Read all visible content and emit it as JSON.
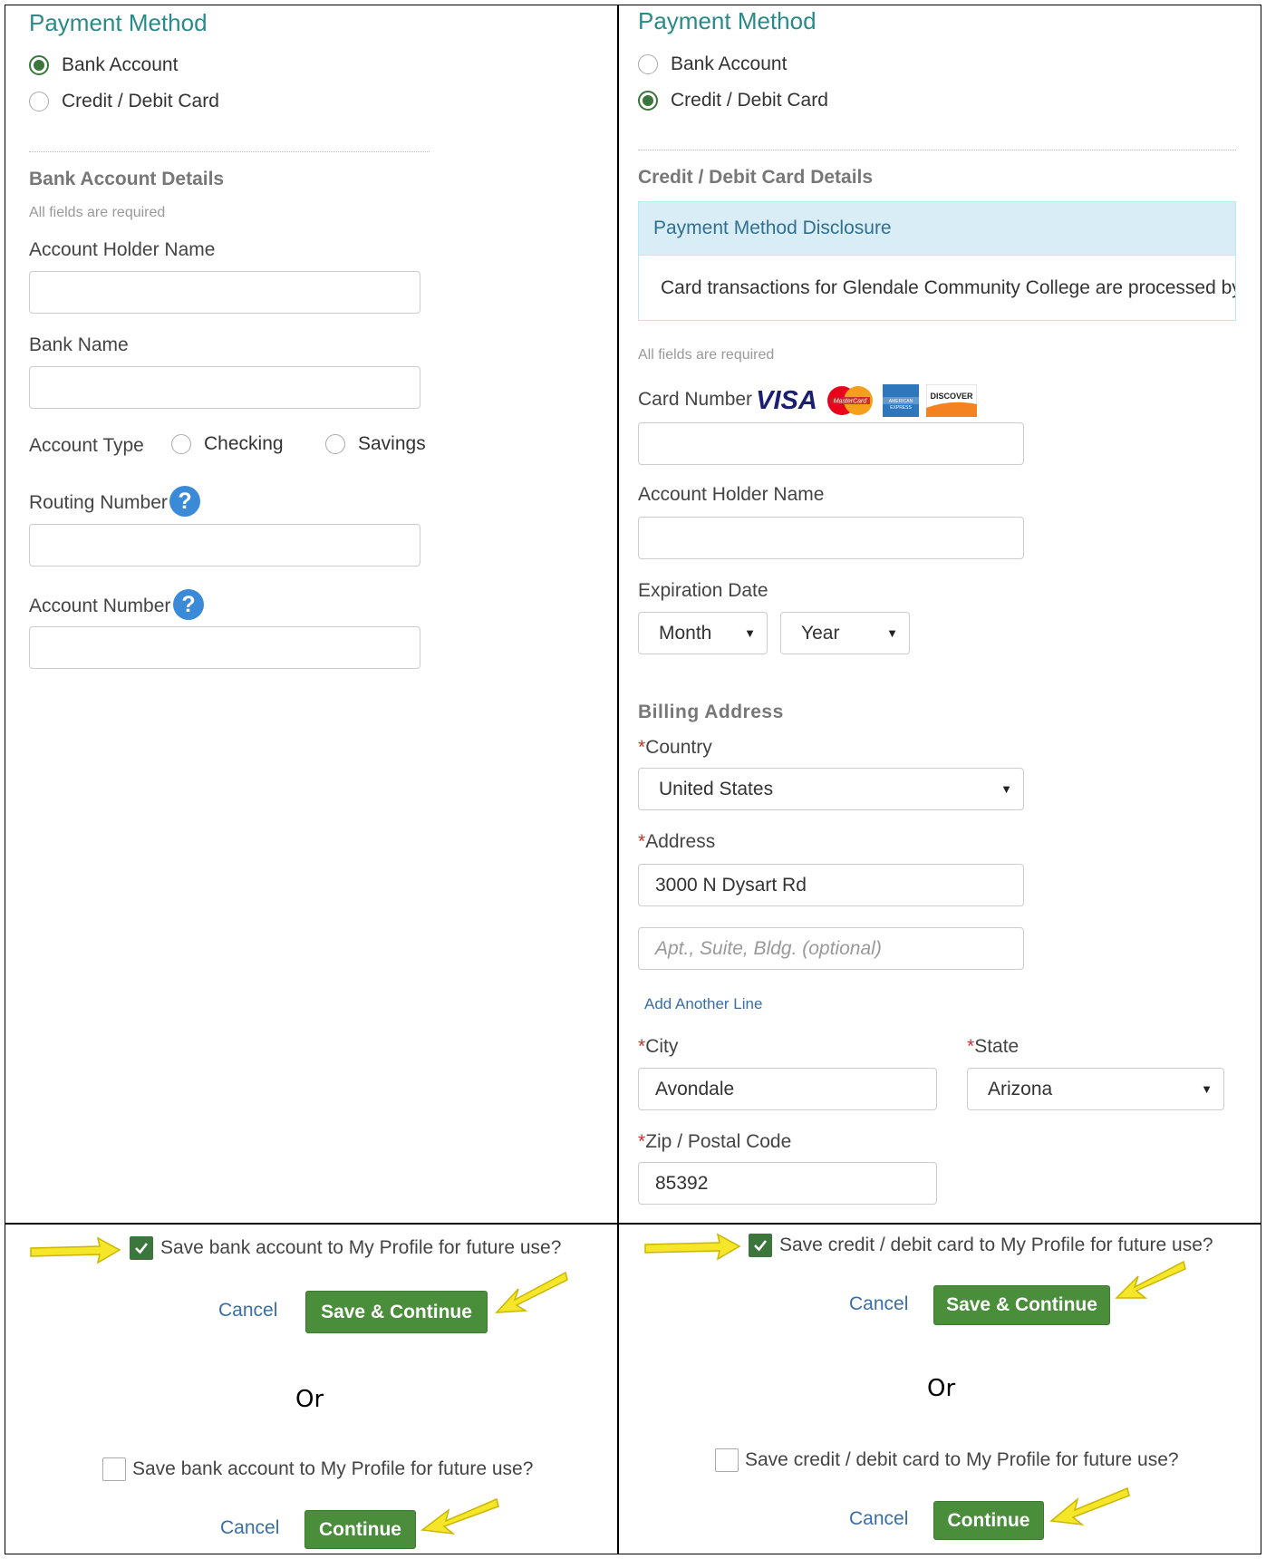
{
  "left": {
    "heading": "Payment Method",
    "radios": [
      "Bank Account",
      "Credit / Debit Card"
    ],
    "selected": "Bank Account",
    "section_title": "Bank Account Details",
    "required_note": "All fields are required",
    "fields": {
      "holder_label": "Account Holder Name",
      "bank_label": "Bank Name",
      "type_label": "Account Type",
      "type_options": [
        "Checking",
        "Savings"
      ],
      "routing_label": "Routing Number",
      "account_label": "Account Number"
    },
    "save_check_label": "Save bank account to My Profile for future use?",
    "cancel": "Cancel",
    "save_continue": "Save & Continue",
    "or": "Or",
    "continue": "Continue"
  },
  "right": {
    "heading": "Payment Method",
    "radios": [
      "Bank Account",
      "Credit / Debit Card"
    ],
    "selected": "Credit / Debit Card",
    "section_title": "Credit / Debit Card Details",
    "disclosure_title": "Payment Method Disclosure",
    "disclosure_text": "Card transactions for Glendale Community College are processed by N",
    "required_note": "All fields are required",
    "card_number_label": "Card Number",
    "card_logos": {
      "visa": "VISA",
      "mastercard": "MasterCard",
      "amex": "AMERICAN EXPRESS",
      "discover": "DISCOVER"
    },
    "holder_label": "Account Holder Name",
    "expiration_label": "Expiration Date",
    "month": "Month",
    "year": "Year",
    "billing_title": "Billing Address",
    "country_label": "Country",
    "country_value": "United States",
    "address_label": "Address",
    "address_value": "3000 N Dysart Rd",
    "address2_placeholder": "Apt., Suite, Bldg. (optional)",
    "add_line": "Add Another Line",
    "city_label": "City",
    "city_value": "Avondale",
    "state_label": "State",
    "state_value": "Arizona",
    "zip_label": "Zip / Postal Code",
    "zip_value": "85392",
    "required_mark": "*",
    "save_check_label": "Save credit / debit card to My Profile for future use?",
    "cancel": "Cancel",
    "save_continue": "Save & Continue",
    "or": "Or",
    "continue": "Continue"
  },
  "colors": {
    "accent": "#2a8a87",
    "button": "#4a8d3b",
    "arrow": "#f5e62a",
    "link": "#3a6ea5"
  }
}
